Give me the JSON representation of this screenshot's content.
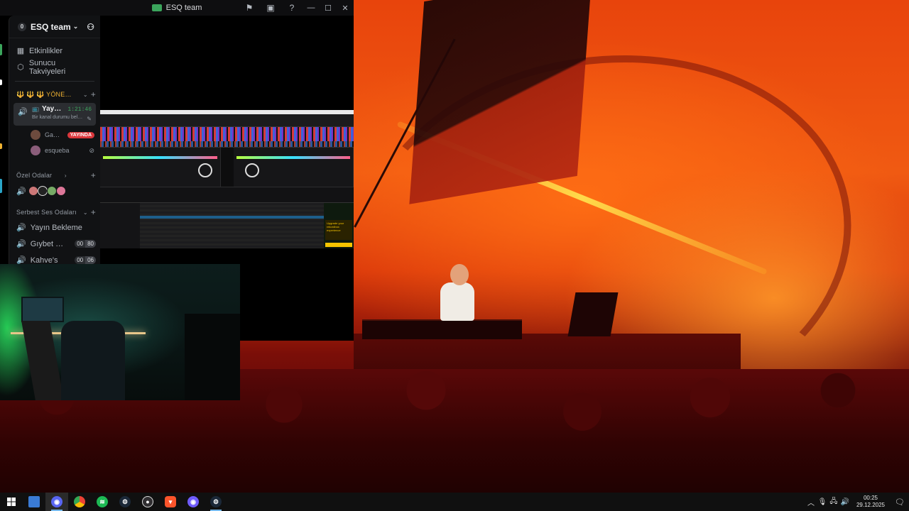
{
  "window": {
    "title": "ESQ team",
    "controls": {
      "minimize": "—",
      "maximize": "☐",
      "close": "✕"
    }
  },
  "sidebar": {
    "server_badge": "0",
    "server_name": "ESQ team",
    "nav": [
      {
        "label": "Etkinlikler",
        "icon": "calendar-icon"
      },
      {
        "label": "Sunucu Takviyeleri",
        "icon": "boost-icon"
      }
    ],
    "category_admin": "🔱 🔱 🔱 YÖNE…",
    "active_voice": {
      "name": "Yay…",
      "timer": "1:21:46",
      "status": "Bir kanal durumu bel…"
    },
    "members": [
      {
        "name": "Ga…",
        "badge": "YAYINDA"
      },
      {
        "name": "esqueba",
        "badge": ""
      }
    ],
    "category_private": "Özel Odalar",
    "category_free": "Serbest Ses Odaları",
    "voice_channels": [
      {
        "name": "Yayın Bekleme",
        "users": "",
        "limit": ""
      },
      {
        "name": "Gıybet …",
        "users": "00",
        "limit": "80"
      },
      {
        "name": "Kahve's",
        "users": "00",
        "limit": "06"
      }
    ]
  },
  "screen_share": {
    "app": "rekordbox",
    "ad_text": "Upgrade your rekordbox experience"
  },
  "taskbar": {
    "apps": [
      "start",
      "file-explorer",
      "discord",
      "chrome",
      "spotify",
      "steam",
      "obs",
      "brave",
      "discord-ptb",
      "steam-2"
    ],
    "time": "00:25",
    "date": "29.12.2025"
  },
  "colors": {
    "discord_green": "#3ba55c",
    "live_red": "#da373c",
    "concert_orange": "#f05a12"
  }
}
